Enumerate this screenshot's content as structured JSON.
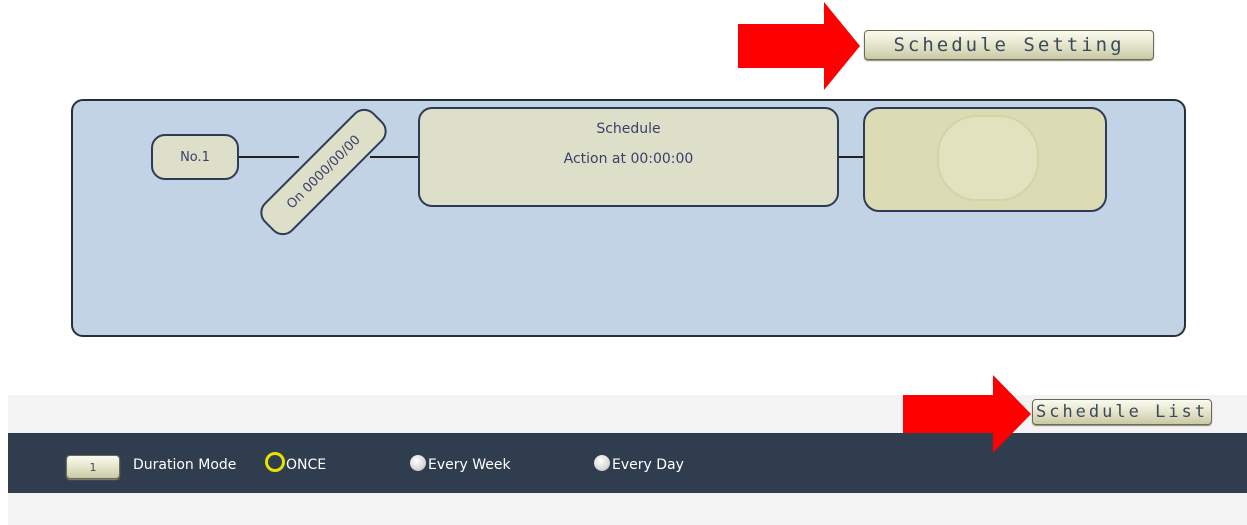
{
  "header": {
    "schedule_setting_label": "Schedule Setting"
  },
  "diagram": {
    "no_label": "No.1",
    "date_label": "On 0000/00/00",
    "schedule_title": "Schedule",
    "schedule_action": "Action at 00:00:00"
  },
  "list": {
    "schedule_list_label": "Schedule List"
  },
  "controls": {
    "number_value": "1",
    "duration_mode_label": "Duration Mode",
    "options": [
      {
        "label": "ONCE",
        "selected": true
      },
      {
        "label": "Every Week",
        "selected": false
      },
      {
        "label": "Every Day",
        "selected": false
      }
    ]
  },
  "colors": {
    "arrow": "#ff0000",
    "panel": "#c2d3e5",
    "darkbar": "#2f3d4f",
    "selected_radio": "#e8e200"
  }
}
